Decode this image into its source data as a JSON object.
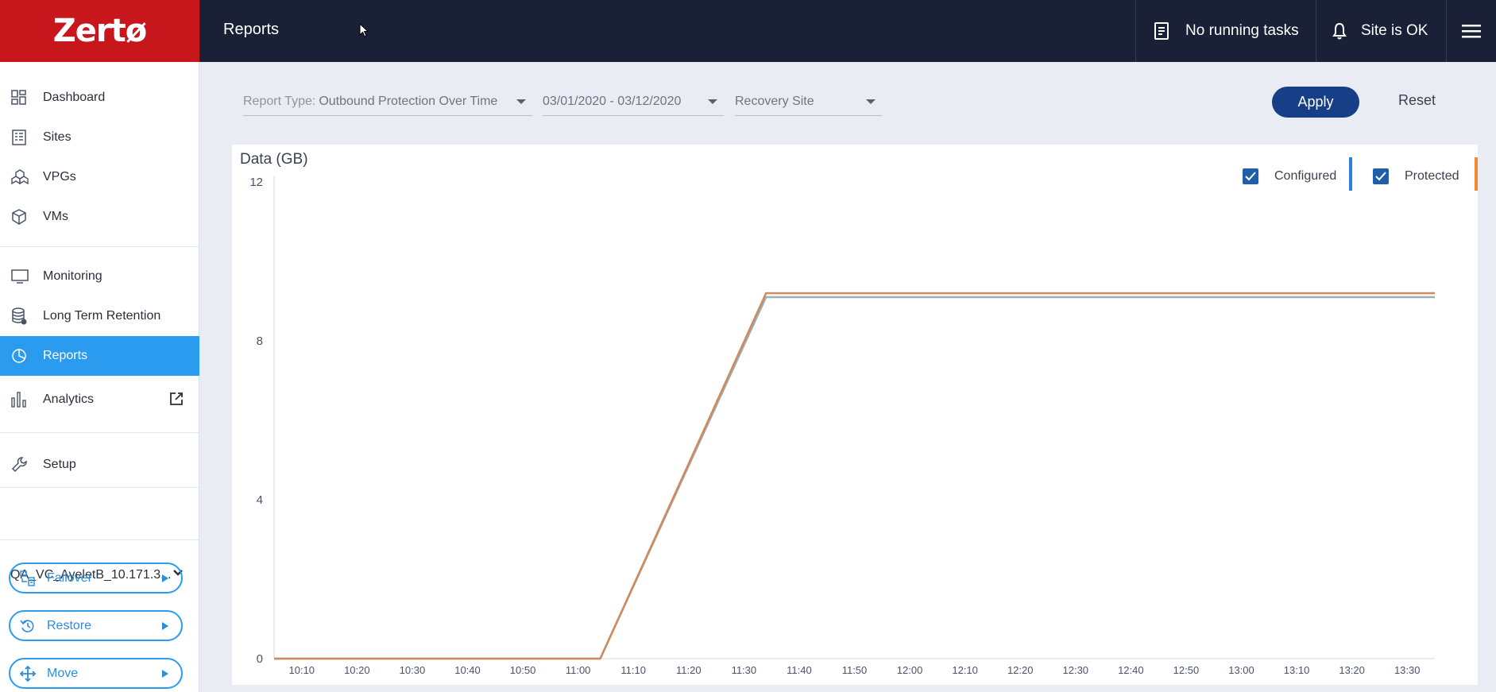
{
  "app": {
    "logo": "Zertø",
    "page_title": "Reports"
  },
  "topbar": {
    "tasks": "No running tasks",
    "site_status": "Site is OK"
  },
  "sidebar": {
    "items": [
      {
        "label": "Dashboard",
        "icon": "dashboard-icon"
      },
      {
        "label": "Sites",
        "icon": "sites-icon"
      },
      {
        "label": "VPGs",
        "icon": "vpgs-icon"
      },
      {
        "label": "VMs",
        "icon": "vms-icon"
      },
      {
        "label": "Monitoring",
        "icon": "monitor-icon"
      },
      {
        "label": "Long Term Retention",
        "icon": "database-icon"
      },
      {
        "label": "Reports",
        "icon": "pie-chart-icon",
        "active": true
      },
      {
        "label": "Analytics",
        "icon": "bar-chart-icon"
      },
      {
        "label": "Setup",
        "icon": "wrench-icon"
      }
    ],
    "site_selector": "QA_VC_AyeletB_10.171.3...",
    "actions": [
      {
        "label": "Failover",
        "icon": "failover-icon"
      },
      {
        "label": "Restore",
        "icon": "restore-icon"
      },
      {
        "label": "Move",
        "icon": "move-icon"
      }
    ]
  },
  "filters": {
    "report_type_label": "Report Type:",
    "report_type_value": "Outbound Protection Over Time",
    "date_range": "03/01/2020 - 03/12/2020",
    "recovery_site": "Recovery Site",
    "apply_label": "Apply",
    "reset_label": "Reset"
  },
  "colors": {
    "brand": "#c8161d",
    "topbar": "#1a2035",
    "accent": "#2b9bf0",
    "apply": "#173f88",
    "configured": "#2b7fd6",
    "protected": "#f28a2b"
  },
  "chart_data": {
    "type": "line",
    "title": "",
    "ylabel": "Data (GB)",
    "xlabel": "",
    "ylim": [
      0,
      12
    ],
    "yticks": [
      "0",
      "4",
      "8",
      "12"
    ],
    "xticks": [
      "10:10",
      "10:20",
      "10:30",
      "10:40",
      "10:50",
      "11:00",
      "11:10",
      "11:20",
      "11:30",
      "11:40",
      "11:50",
      "12:00",
      "12:10",
      "12:20",
      "12:30",
      "12:40",
      "12:50",
      "13:00",
      "13:10",
      "13:20",
      "13:30"
    ],
    "x_range": [
      "10:05",
      "13:35"
    ],
    "series": [
      {
        "name": "Configured",
        "color": "#9aaebc",
        "points": [
          [
            "10:05",
            0
          ],
          [
            "11:04",
            0
          ],
          [
            "11:34",
            9.1
          ],
          [
            "13:35",
            9.1
          ]
        ]
      },
      {
        "name": "Protected",
        "color": "#d08a5a",
        "points": [
          [
            "10:05",
            0
          ],
          [
            "11:04",
            0
          ],
          [
            "11:34",
            9.2
          ],
          [
            "13:35",
            9.2
          ]
        ]
      }
    ],
    "legend": [
      {
        "label": "Configured",
        "checked": true
      },
      {
        "label": "Protected",
        "checked": true
      }
    ],
    "legend_position": "top-right",
    "grid": false
  }
}
